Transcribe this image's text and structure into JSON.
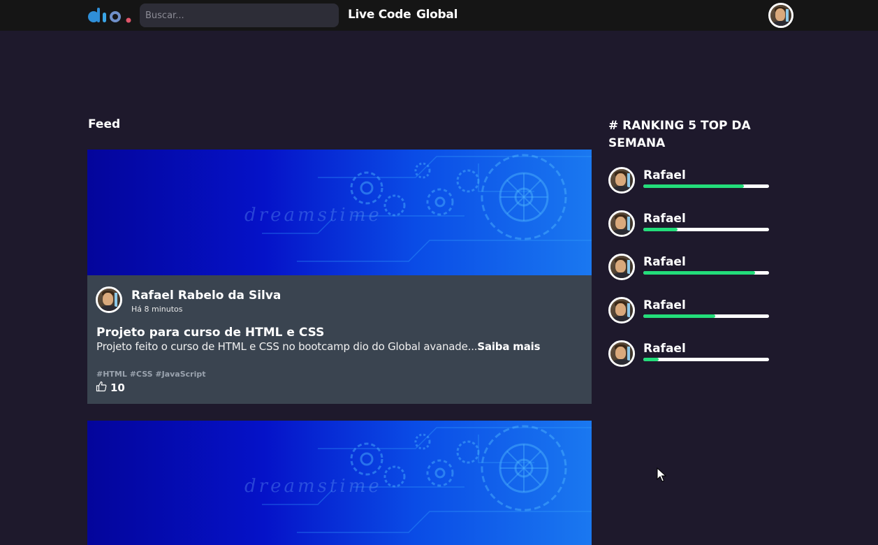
{
  "header": {
    "logo_icon": "dio-logo",
    "search": {
      "placeholder": "Buscar..."
    },
    "nav": [
      {
        "label": "Live Code"
      },
      {
        "label": "Global"
      }
    ],
    "user_avatar": "user-avatar"
  },
  "feed": {
    "title": "Feed",
    "posts": [
      {
        "banner_icon": "gears-banner-image",
        "author": "Rafael Rabelo da Silva",
        "time": "Há 8 minutos",
        "title": "Projeto para curso de HTML e CSS",
        "description": "Projeto feito o curso de HTML e CSS no bootcamp dio do Global avanade...",
        "read_more": "Saiba mais",
        "tags": "#HTML #CSS #JavaScript",
        "likes": "10"
      },
      {
        "banner_icon": "gears-banner-image"
      }
    ]
  },
  "ranking": {
    "title": "# RANKING 5 TOP DA SEMANA",
    "items": [
      {
        "name": "Rafael",
        "progress": 0.8
      },
      {
        "name": "Rafael",
        "progress": 0.27
      },
      {
        "name": "Rafael",
        "progress": 0.89
      },
      {
        "name": "Rafael",
        "progress": 0.57
      },
      {
        "name": "Rafael",
        "progress": 0.12
      }
    ]
  },
  "colors": {
    "background": "#1e192c",
    "header": "#151515",
    "card": "#3a4450",
    "progress": "#23dd7a",
    "logo_blue": "#2f8fd8",
    "logo_red": "#e0566a"
  }
}
